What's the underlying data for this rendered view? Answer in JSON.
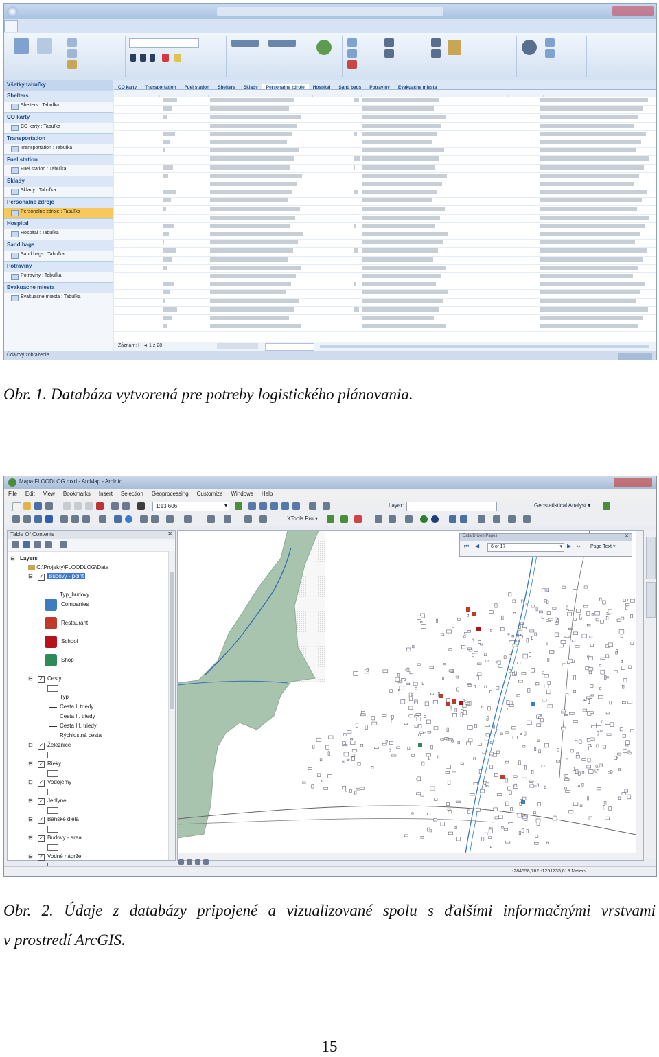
{
  "figure1": {
    "caption": "Obr. 1. Databáza vytvorená pre potreby logistického plánovania.",
    "nav_items": [
      {
        "group": "Shelters",
        "table": "Shelters : Tabuľka"
      },
      {
        "group": "CO karty",
        "table": "CO karty : Tabuľka"
      },
      {
        "group": "Transportation",
        "table": "Transportation : Tabuľka"
      },
      {
        "group": "Fuel station",
        "table": "Fuel station : Tabuľka"
      },
      {
        "group": "Sklady",
        "table": "Sklady : Tabuľka"
      },
      {
        "group": "Personalne zdroje",
        "table": "Personalne zdroje : Tabuľka"
      },
      {
        "group": "Hospital",
        "table": "Hospital : Tabuľka"
      },
      {
        "group": "Sand bags",
        "table": "Sand bags : Tabuľka"
      },
      {
        "group": "Potraviny",
        "table": "Potraviny : Tabuľka"
      },
      {
        "group": "Evakuacne miesta",
        "table": "Evakuacne miesta : Tabuľka"
      }
    ],
    "doc_tabs": [
      "CO karty",
      "Transportation",
      "Fuel station",
      "Shelters",
      "Sklady",
      "Personalne zdroje",
      "Hospital",
      "Sand bags",
      "Potraviny",
      "Evakuacne miesta"
    ],
    "active_doc_tab": "Personalne zdroje",
    "nav_pane_title": "Všetky tabuľky",
    "record_nav": "Záznam: H ◄ 1 z 28",
    "row_count": 28,
    "status_left": "Údajový zobrazenie"
  },
  "figure2": {
    "caption": "Obr. 2. Údaje z databázy pripojené a vizualizované spolu s ďalšími informačnými vrstvami v prostredí ArcGIS.",
    "title": "Mapa FLOODLOG.mxd - ArcMap - ArcInfo",
    "menu": [
      "File",
      "Edit",
      "View",
      "Bookmarks",
      "Insert",
      "Selection",
      "Geoprocessing",
      "Customize",
      "Windows",
      "Help"
    ],
    "scale": "1:13 606",
    "toc_title": "Table Of Contents",
    "layers_root": "Layers",
    "data_path": "C:\\Projekty\\FLOODLOG\\Data",
    "layers": [
      {
        "label": "Budovy - point",
        "indent": 2,
        "checkbox": true,
        "selected": true
      },
      {
        "label": "Typ_budovy",
        "indent": 3
      },
      {
        "label": "Companies",
        "indent": 3,
        "symbol": "company"
      },
      {
        "label": "Restaurant",
        "indent": 3,
        "symbol": "restaurant"
      },
      {
        "label": "School",
        "indent": 3,
        "symbol": "school"
      },
      {
        "label": "Shop",
        "indent": 3,
        "symbol": "shop"
      },
      {
        "label": "Cesty",
        "indent": 2,
        "checkbox": true
      },
      {
        "label": "Typ",
        "indent": 3
      },
      {
        "label": "Cesta I. triedy",
        "indent": 3,
        "symbol": "line"
      },
      {
        "label": "Cesta II. triedy",
        "indent": 3,
        "symbol": "line"
      },
      {
        "label": "Cesta III. triedy",
        "indent": 3,
        "symbol": "line"
      },
      {
        "label": "Rýchlostná cesta",
        "indent": 3,
        "symbol": "line"
      },
      {
        "label": "Železnice",
        "indent": 2,
        "checkbox": true
      },
      {
        "label": "Rieky",
        "indent": 2,
        "checkbox": true
      },
      {
        "label": "Vodojemy",
        "indent": 2,
        "checkbox": true
      },
      {
        "label": "Jedlyne",
        "indent": 2,
        "checkbox": true
      },
      {
        "label": "Banské diela",
        "indent": 2,
        "checkbox": true
      },
      {
        "label": "Budovy - area",
        "indent": 2,
        "checkbox": true
      },
      {
        "label": "Vodné nádrže",
        "indent": 2,
        "checkbox": true
      }
    ],
    "layer_label": "Layer:",
    "geostat_label": "Geostatistical Analyst ▾",
    "ddp_title": "Data Driven Pages",
    "ddp_page": "6 of 17",
    "ddp_page_text": "Page Text ▾",
    "xtools_label": "XTools Pro ▾",
    "coordinates": "-284558,762  -1251235,618 Meters"
  },
  "page_number": "15"
}
